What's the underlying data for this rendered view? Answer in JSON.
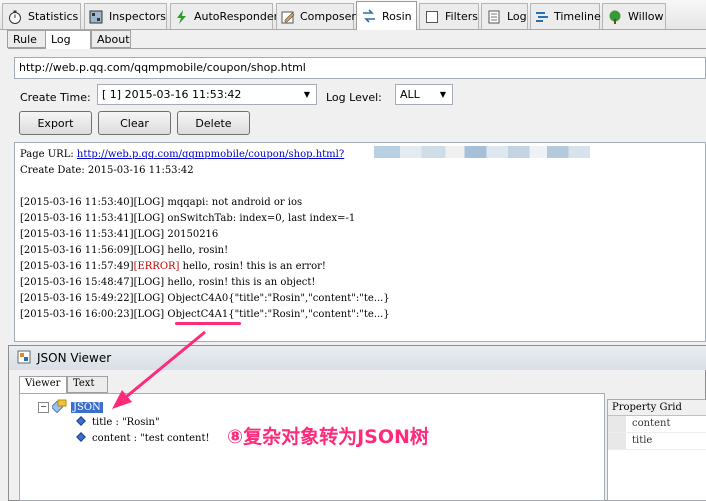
{
  "top_tabs": [
    {
      "label": "Statistics",
      "icon": "timer-icon"
    },
    {
      "label": "Inspectors",
      "icon": "inspectors-icon"
    },
    {
      "label": "AutoResponder",
      "icon": "lightning-icon"
    },
    {
      "label": "Composer",
      "icon": "composer-icon"
    },
    {
      "label": "Rosin",
      "icon": "rosin-arrows-icon"
    },
    {
      "label": "Filters",
      "icon": "checkbox-icon"
    },
    {
      "label": "Log",
      "icon": "log-icon"
    },
    {
      "label": "Timeline",
      "icon": "timeline-icon"
    },
    {
      "label": "Willow",
      "icon": "willow-tree-icon"
    }
  ],
  "sub_tabs": [
    "Rule",
    "Log",
    "About"
  ],
  "url": "http://web.p.qq.com/qqmpmobile/coupon/shop.html",
  "controls": {
    "create_time_label": "Create Time:",
    "create_time_value": "[ 1] 2015-03-16 11:53:42",
    "log_level_label": "Log Level:",
    "log_level_value": "ALL",
    "export_label": "Export",
    "clear_label": "Clear",
    "delete_label": "Delete"
  },
  "log": {
    "page_url_label": "Page URL:",
    "page_url_link": "http://web.p.qq.com/qqmpmobile/coupon/shop.html?",
    "create_date": "Create Date: 2015-03-16 11:53:42",
    "lines": [
      {
        "time": "[2015-03-16 11:53:40]",
        "level": "[LOG]",
        "msg": " mqqapi: not android or ios"
      },
      {
        "time": "[2015-03-16 11:53:41]",
        "level": "[LOG]",
        "msg": " onSwitchTab: index=0, last index=-1"
      },
      {
        "time": "[2015-03-16 11:53:41]",
        "level": "[LOG]",
        "msg": " 20150216"
      },
      {
        "time": "[2015-03-16 11:56:09]",
        "level": "[LOG]",
        "msg": " hello, rosin!"
      },
      {
        "time": "[2015-03-16 11:57:49]",
        "level": "[ERROR]",
        "msg": " hello, rosin! this is an error!"
      },
      {
        "time": "[2015-03-16 15:48:47]",
        "level": "[LOG]",
        "msg": " hello, rosin! this is an object!"
      },
      {
        "time": "[2015-03-16 15:49:22]",
        "level": "[LOG]",
        "msg": " ObjectC4A0{\"title\":\"Rosin\",\"content\":\"te...}"
      },
      {
        "time": "[2015-03-16 16:00:23]",
        "level": "[LOG]",
        "msg": " ObjectC4A1{\"title\":\"Rosin\",\"content\":\"te...}"
      }
    ]
  },
  "json_viewer": {
    "title": "JSON Viewer",
    "tabs": [
      "Viewer",
      "Text"
    ],
    "root": "JSON",
    "nodes": [
      "title : \"Rosin\"",
      "content : \"test content!"
    ],
    "property_grid_title": "Property Grid",
    "property_grid_rows": [
      "content",
      "title"
    ]
  },
  "annotation": "⑧复杂对象转为JSON树",
  "colors": {
    "accent_annotation": "#ff2a7a",
    "error": "#cc0000",
    "link": "#0000cc"
  }
}
